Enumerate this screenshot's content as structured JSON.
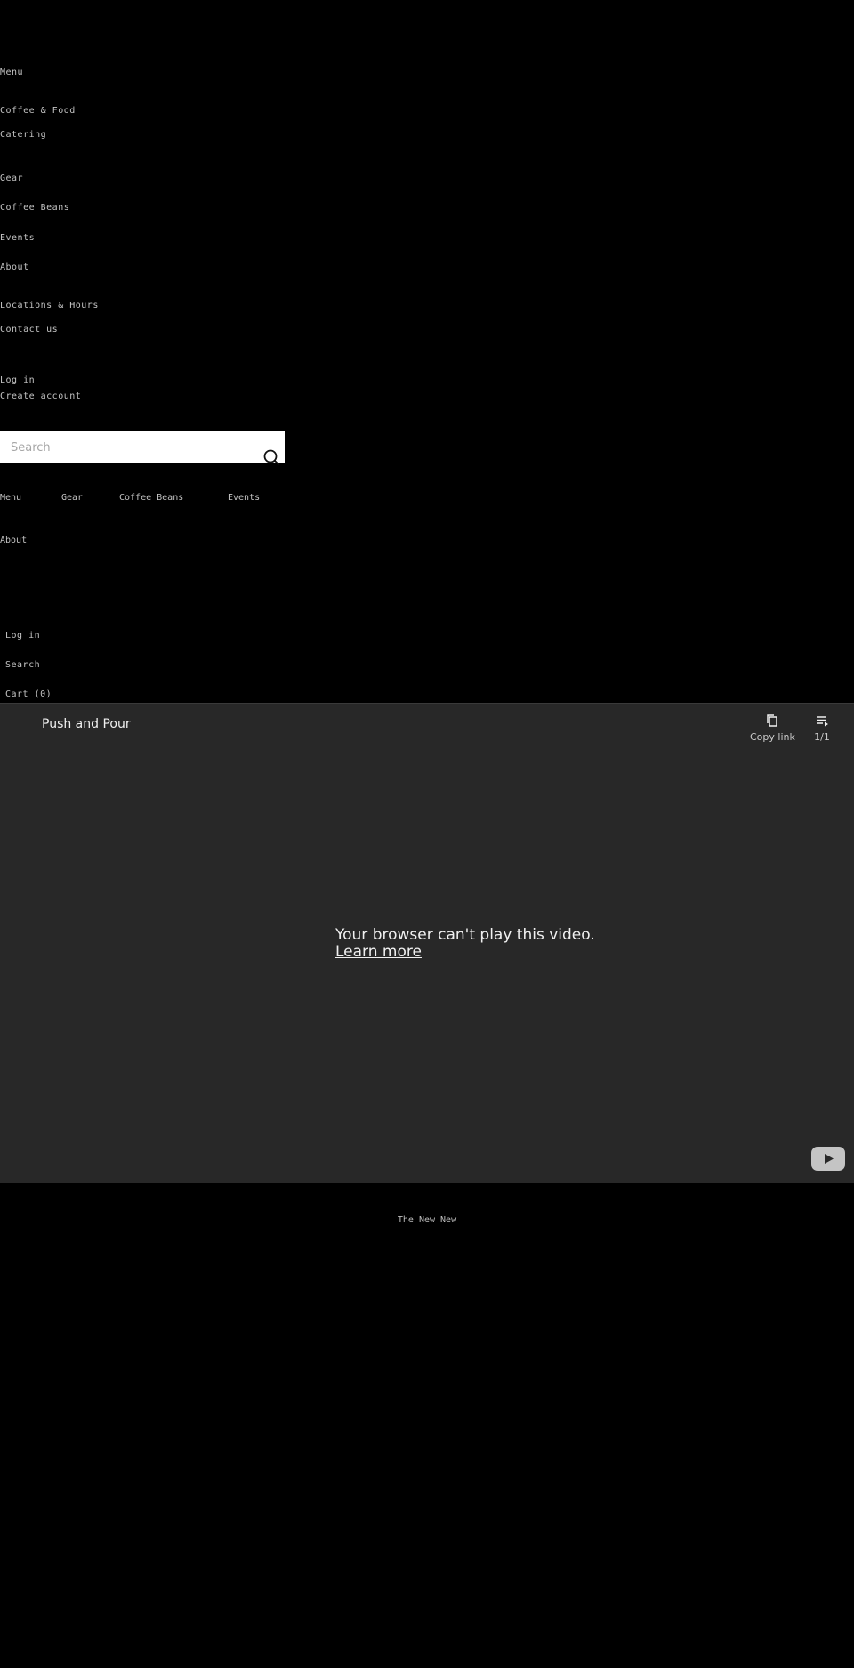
{
  "nav": {
    "menu": "Menu",
    "coffee_food": "Coffee & Food",
    "catering": "Catering",
    "gear": "Gear",
    "coffee_beans": "Coffee Beans",
    "events": "Events",
    "about": "About",
    "locations_hours": "Locations & Hours",
    "contact_us": "Contact us",
    "log_in": "Log in",
    "create_account": "Create account"
  },
  "search": {
    "placeholder": "Search",
    "value": "",
    "icon": "search-icon"
  },
  "header_nav": {
    "items": [
      "Menu",
      "Gear",
      "Coffee Beans",
      "Events"
    ],
    "about": "About"
  },
  "header_actions": {
    "log_in": "Log in",
    "search": "Search",
    "cart": "Cart (0)"
  },
  "video": {
    "title": "Push and Pour",
    "copy_link": "Copy link",
    "playlist_position": "1/1",
    "error_message": "Your browser can't play this video.",
    "learn_more": "Learn more",
    "icons": {
      "copy": "copy-icon",
      "playlist": "playlist-icon",
      "logo": "youtube-logo-icon"
    }
  },
  "footer": {
    "text": "The New New"
  },
  "colors": {
    "page_background": "#000000",
    "player_background": "#282828",
    "nav_text": "#c4c4c4",
    "player_text": "#f1f1f1"
  }
}
